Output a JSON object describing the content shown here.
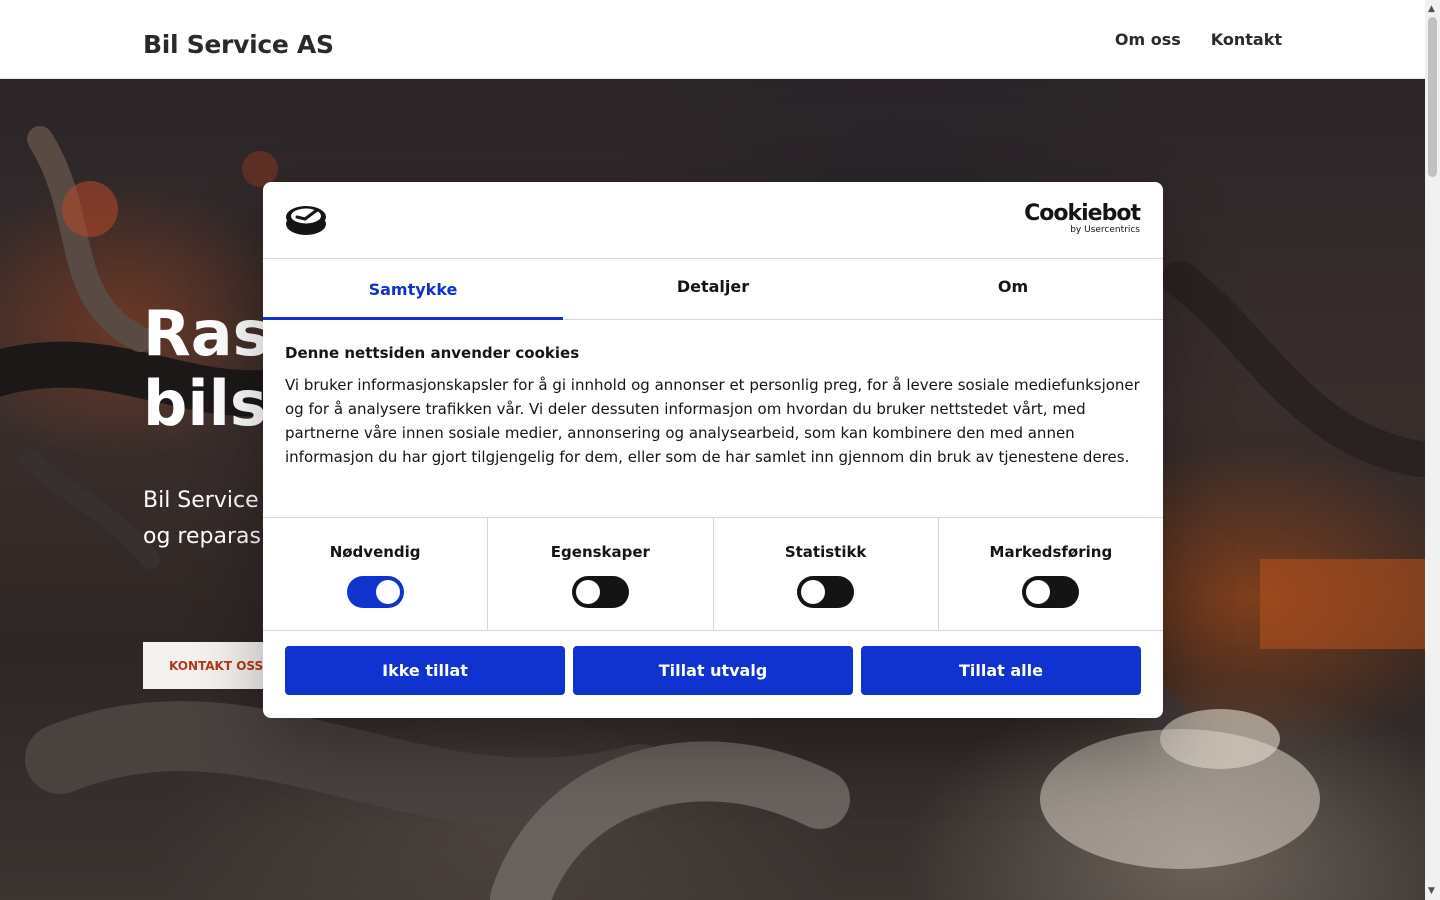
{
  "header": {
    "brand": "Bil Service AS",
    "nav": [
      {
        "label": "Om oss"
      },
      {
        "label": "Kontakt"
      }
    ]
  },
  "hero": {
    "title_line1": "Rask",
    "title_line2": "bilse",
    "text_line1": "Bil Service A",
    "text_line2": "og reparas",
    "cta": "KONTAKT OSS"
  },
  "cookie_dialog": {
    "brand_main": "Cookiebot",
    "brand_sub": "by Usercentrics",
    "tabs": [
      {
        "label": "Samtykke",
        "active": true
      },
      {
        "label": "Detaljer",
        "active": false
      },
      {
        "label": "Om",
        "active": false
      }
    ],
    "heading": "Denne nettsiden anvender cookies",
    "body": "Vi bruker informasjonskapsler for å gi innhold og annonser et personlig preg, for å levere sosiale mediefunksjoner og for å analysere trafikken vår. Vi deler dessuten informasjon om hvordan du bruker nettstedet vårt, med partnerne våre innen sosiale medier, annonsering og analysearbeid, som kan kombinere den med annen informasjon du har gjort tilgjengelig for dem, eller som de har samlet inn gjennom din bruk av tjenestene deres.",
    "toggles": [
      {
        "label": "Nødvendig",
        "on": true
      },
      {
        "label": "Egenskaper",
        "on": false
      },
      {
        "label": "Statistikk",
        "on": false
      },
      {
        "label": "Markedsføring",
        "on": false
      }
    ],
    "buttons": {
      "deny": "Ikke tillat",
      "selection": "Tillat utvalg",
      "allow_all": "Tillat alle"
    },
    "accent_color": "#1032cf"
  }
}
